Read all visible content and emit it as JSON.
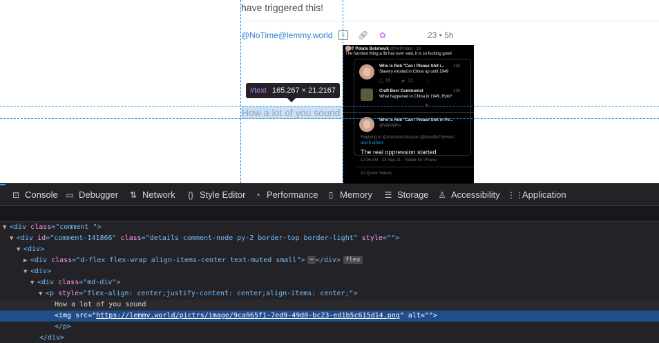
{
  "web": {
    "prev_text": "have triggered this!",
    "author": "@NoTime@lemmy.world",
    "votes": "23 • 5h",
    "comment_text": "How a lot of you sound",
    "tooltip": {
      "tag": "#text",
      "dims": "165.267 × 21.2167"
    },
    "icons": [
      "reply-icon",
      "link-icon",
      "fediverse-icon"
    ]
  },
  "tweet": {
    "top_name": "NOT Potato Bolshevik",
    "top_handle": "@NotPotato · 1h",
    "top_text": "The funniest thing a lib has ever said, it is so fucking good",
    "q1_name": "Who Is Rob \"Can I Please Shit i...",
    "q1_time": "13h",
    "q1_text": "Slavery existed in China up until 1949",
    "q1_stats": [
      "19",
      "21"
    ],
    "q2_name": "Craft Beer Communist",
    "q2_time": "13h",
    "q2_text": "What happened in China in 1949, Rob?",
    "main_name": "Who Is Rob \"Can I Please Shit in Pe...",
    "main_handle": "@WillsWho",
    "reply_to": "Replying to @IAmJacksDespair @MustBeTheHero",
    "reply_to2": "and 6 others",
    "main_text": "The real oppression started",
    "main_meta": "12:06 AM · 23 Sep 21 · Twitter for iPhone",
    "quotes": "10 Quote Tweets"
  },
  "devtools": {
    "tabs": [
      {
        "icon": "console-icon",
        "glyph": "⊡",
        "label": "Console"
      },
      {
        "icon": "debugger-icon",
        "glyph": "▭",
        "label": "Debugger"
      },
      {
        "icon": "network-icon",
        "glyph": "⇅",
        "label": "Network"
      },
      {
        "icon": "style-editor-icon",
        "glyph": "{}",
        "label": "Style Editor"
      },
      {
        "icon": "performance-icon",
        "glyph": "◔",
        "label": "Performance"
      },
      {
        "icon": "memory-icon",
        "glyph": "▯",
        "label": "Memory"
      },
      {
        "icon": "storage-icon",
        "glyph": "☰",
        "label": "Storage"
      },
      {
        "icon": "accessibility-icon",
        "glyph": "♙",
        "label": "Accessibility"
      },
      {
        "icon": "application-icon",
        "glyph": "⋮⋮",
        "label": "Application"
      }
    ],
    "tree": {
      "l1_tag_open": "<div",
      "l1_attr": "class",
      "l1_val": "\"comment \"",
      "l1_close": ">",
      "l2_tag_open": "<div",
      "l2_attr_id": "id",
      "l2_val_id": "\"comment-141866\"",
      "l2_attr_class": "class",
      "l2_val_class": "\"details comment-node py-2 border-top border-light\"",
      "l2_attr_style": "style",
      "l2_val_style": "\"\"",
      "l2_close": ">",
      "l3": "<div>",
      "l4_tag_open": "<div",
      "l4_attr": "class",
      "l4_val": "\"d-flex flex-wrap align-items-center text-muted small\"",
      "l4_close": ">",
      "l4_ellipsis": "⋯",
      "l4_end": "</div>",
      "l4_badge": "flex",
      "l5": "<div>",
      "l6_tag_open": "<div",
      "l6_attr": "class",
      "l6_val": "\"md-div\"",
      "l6_close": ">",
      "l7_tag_open": "<p",
      "l7_attr": "style",
      "l7_val": "\"flex-align: center;justify-content: center;align-items: center;\"",
      "l7_close": ">",
      "l8_text": "How a lot of you sound",
      "l9_tag_open": "<img",
      "l9_attr_src": "src",
      "l9_link": "https://lemmy.world/pictrs/image/9ca965f1-7ed9-49d0-bc23-ed1b5c615d14.png",
      "l9_attr_alt": "alt",
      "l9_val_alt": "\"\"",
      "l9_close": ">",
      "l10": "</p>",
      "l11": "</div>"
    }
  }
}
